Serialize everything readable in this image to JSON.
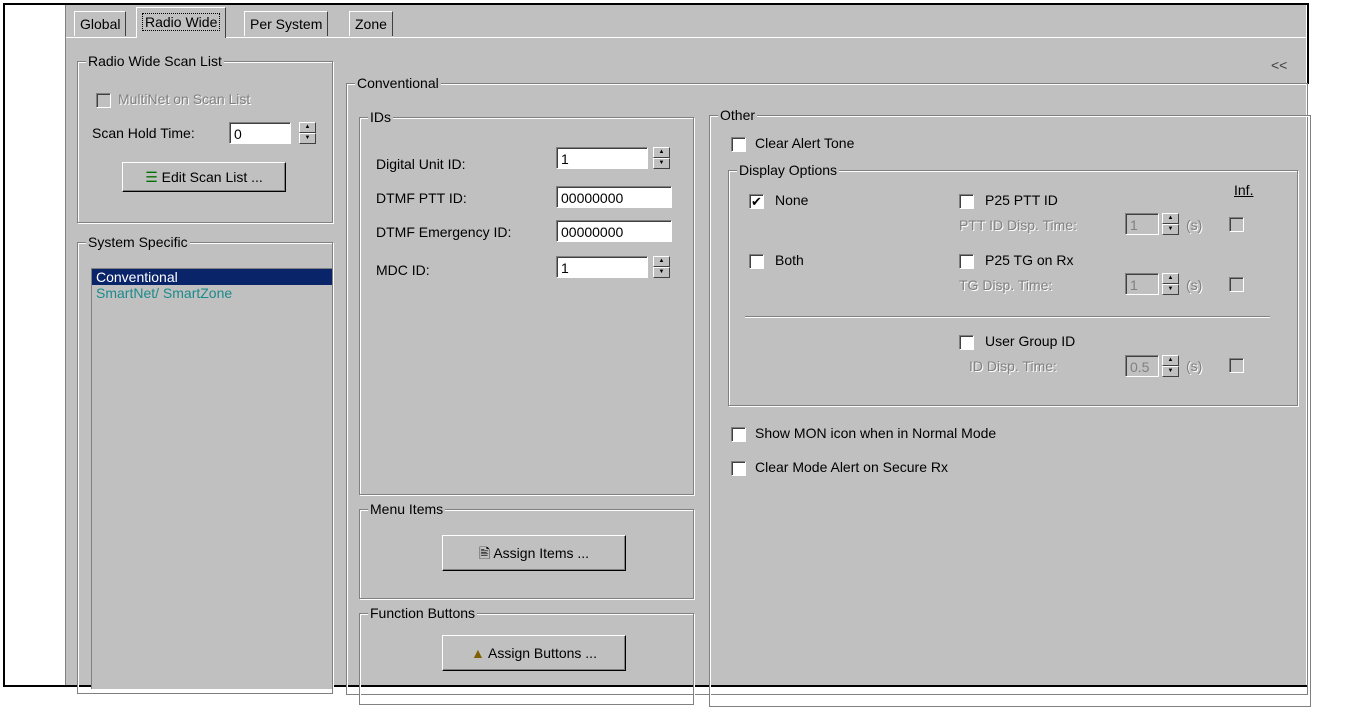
{
  "tabs": [
    "Global",
    "Radio Wide",
    "Per System",
    "Zone"
  ],
  "collapse": "<<",
  "scan_list": {
    "title": "Radio Wide Scan List",
    "multinet_label": "MultiNet on Scan List",
    "hold_label": "Scan Hold Time:",
    "hold_value": "0",
    "edit_button": "Edit Scan List ..."
  },
  "system_specific": {
    "title": "System Specific",
    "items": [
      "Conventional",
      "SmartNet/ SmartZone"
    ]
  },
  "conventional": {
    "title": "Conventional",
    "ids_title": "IDs",
    "digital_unit_label": "Digital Unit ID:",
    "digital_unit_value": "1",
    "dtmf_ptt_label": "DTMF PTT ID:",
    "dtmf_ptt_value": "00000000",
    "dtmf_emerg_label": "DTMF Emergency ID:",
    "dtmf_emerg_value": "00000000",
    "mdc_label": "MDC ID:",
    "mdc_value": "1",
    "menu_title": "Menu Items",
    "assign_items": "Assign Items ...",
    "function_title": "Function Buttons",
    "assign_buttons": "Assign Buttons ..."
  },
  "other": {
    "title": "Other",
    "clear_alert": "Clear Alert Tone",
    "display_title": "Display Options",
    "inf_label": "Inf.",
    "none_label": "None",
    "both_label": "Both",
    "p25_ptt_label": "P25 PTT ID",
    "ptt_disp_label": "PTT ID Disp. Time:",
    "ptt_disp_value": "1",
    "p25_tg_label": "P25 TG on Rx",
    "tg_disp_label": "TG Disp. Time:",
    "tg_disp_value": "1",
    "user_group_label": "User Group ID",
    "id_disp_label": "ID Disp. Time:",
    "id_disp_value": "0.5",
    "unit_s": "(s)",
    "show_mon": "Show MON icon when in Normal Mode",
    "clear_mode": "Clear Mode Alert on Secure Rx"
  }
}
